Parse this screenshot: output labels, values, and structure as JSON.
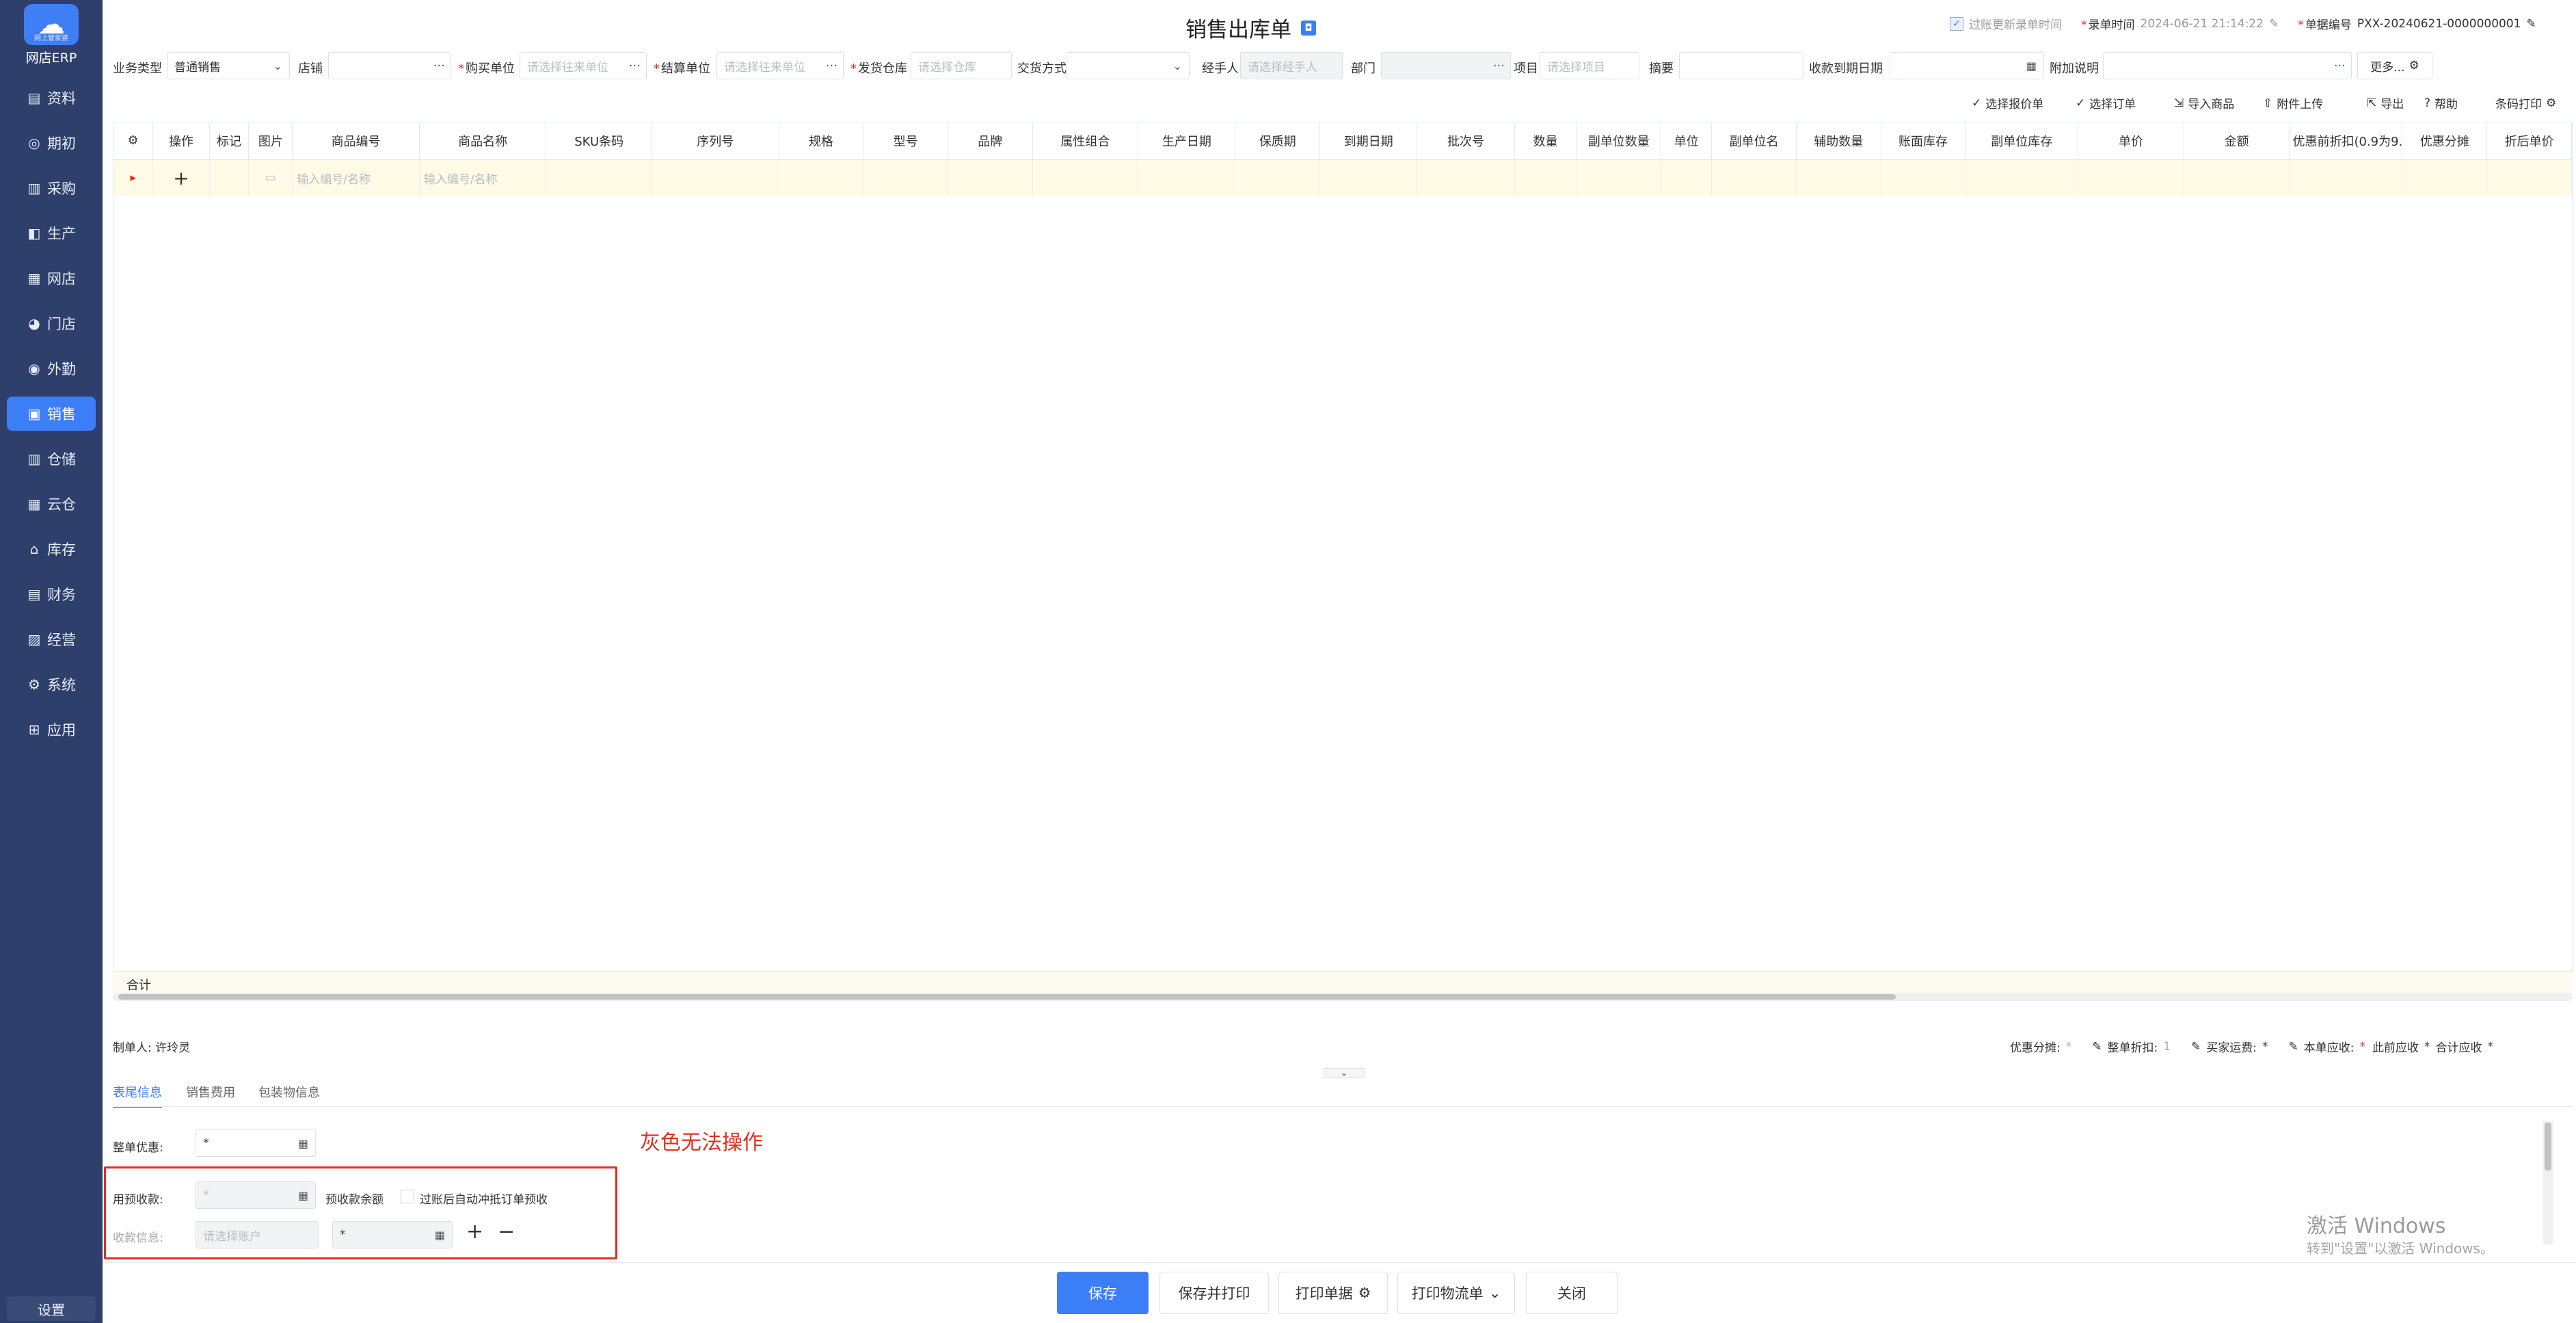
{
  "sidebar": {
    "logo_sub": "网上管家婆",
    "app_name": "网店ERP",
    "items": [
      {
        "label": "资料",
        "icon": "▤"
      },
      {
        "label": "期初",
        "icon": "◎"
      },
      {
        "label": "采购",
        "icon": "▥"
      },
      {
        "label": "生产",
        "icon": "◧"
      },
      {
        "label": "网店",
        "icon": "▦"
      },
      {
        "label": "门店",
        "icon": "◕"
      },
      {
        "label": "外勤",
        "icon": "◉"
      },
      {
        "label": "销售",
        "icon": "▣"
      },
      {
        "label": "仓储",
        "icon": "▥"
      },
      {
        "label": "云仓",
        "icon": "▦"
      },
      {
        "label": "库存",
        "icon": "⌂"
      },
      {
        "label": "财务",
        "icon": "▤"
      },
      {
        "label": "经营",
        "icon": "▨"
      },
      {
        "label": "系统",
        "icon": "⚙"
      },
      {
        "label": "应用",
        "icon": "⊞"
      }
    ],
    "settings": "设置"
  },
  "header": {
    "title": "销售出库单",
    "update_time_label": "过账更新录单时间",
    "entry_time_label": "录单时间",
    "entry_time": "2024-06-21 21:14:22",
    "doc_no_label": "单据编号",
    "doc_no": "PXX-20240621-0000000001"
  },
  "form": {
    "biz_type_label": "业务类型",
    "biz_type": "普通销售",
    "store_label": "店铺",
    "buyer_label": "购买单位",
    "buyer_ph": "请选择往来单位",
    "settle_label": "结算单位",
    "settle_ph": "请选择往来单位",
    "warehouse_label": "发货仓库",
    "warehouse_ph": "请选择仓库",
    "delivery_label": "交货方式",
    "handler_label": "经手人",
    "handler_ph": "请选择经手人",
    "dept_label": "部门",
    "project_label": "项目",
    "project_ph": "请选择项目",
    "summary_label": "摘要",
    "due_label": "收款到期日期",
    "note_label": "附加说明",
    "more": "更多..."
  },
  "toolbar": {
    "quote": "选择报价单",
    "order": "选择订单",
    "import": "导入商品",
    "upload": "附件上传",
    "export": "导出",
    "help": "帮助",
    "barcode": "条码打印"
  },
  "grid": {
    "columns": [
      "操作",
      "标记",
      "图片",
      "商品编号",
      "商品名称",
      "SKU条码",
      "序列号",
      "规格",
      "型号",
      "品牌",
      "属性组合",
      "生产日期",
      "保质期",
      "到期日期",
      "批次号",
      "数量",
      "副单位数量",
      "单位",
      "副单位名",
      "辅助数量",
      "账面库存",
      "副单位库存",
      "单价",
      "金额",
      "优惠前折扣(0.9为9...",
      "优惠分摊",
      "折后单价"
    ],
    "row_code_ph": "输入编号/名称",
    "row_name_ph": "输入编号/名称",
    "total": "合计"
  },
  "summary": {
    "maker": "制单人: 许玲灵",
    "discount_share": "优惠分摊:",
    "whole_discount": "整单折扣:",
    "whole_discount_val": "1",
    "freight": "买家运费:",
    "receivable": "本单应收:",
    "prev_receivable": "此前应收",
    "total_receivable": "合计应收"
  },
  "tabs": [
    "表尾信息",
    "销售费用",
    "包装物信息"
  ],
  "footer_form": {
    "whole_off_label": "整单优惠:",
    "use_prepay_label": "用预收款:",
    "prepay_balance": "预收款余额",
    "auto_offset": "过账后自动冲抵订单预收",
    "receipt_label": "收款信息:",
    "account_ph": "请选择账户",
    "zero": "*"
  },
  "annotation": "灰色无法操作",
  "watermark": {
    "line1": "激活 Windows",
    "line2": "转到\"设置\"以激活 Windows。"
  },
  "buttons": {
    "save": "保存",
    "save_print": "保存并打印",
    "print_doc": "打印单据",
    "print_logistics": "打印物流单",
    "close": "关闭"
  },
  "colors": {
    "sidebar": "#2f3f6b",
    "accent": "#3c7ef6",
    "annotation": "#e0301e"
  }
}
